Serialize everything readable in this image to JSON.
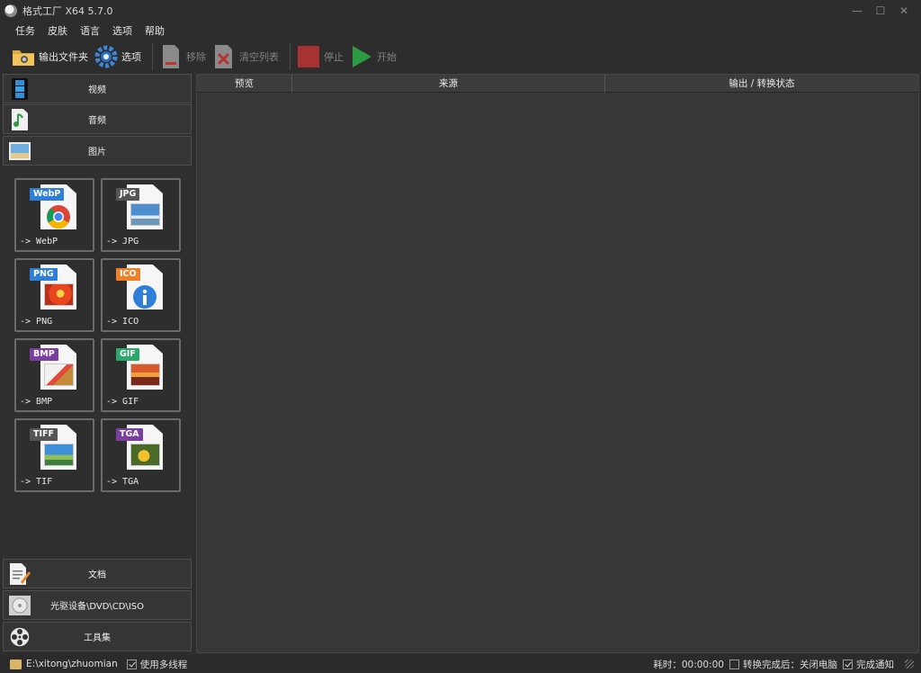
{
  "window": {
    "title": "格式工厂 X64 5.7.0",
    "controls": {
      "minimize": "—",
      "maximize": "☐",
      "close": "✕"
    }
  },
  "menu": [
    "任务",
    "皮肤",
    "语言",
    "选项",
    "帮助"
  ],
  "toolbar": {
    "output_folder": "输出文件夹",
    "options": "选项",
    "remove": "移除",
    "clear_list": "清空列表",
    "stop": "停止",
    "start": "开始"
  },
  "sidebar": {
    "categories_top": [
      {
        "label": "视频",
        "icon": "film-icon"
      },
      {
        "label": "音频",
        "icon": "music-note-icon"
      },
      {
        "label": "图片",
        "icon": "picture-icon"
      }
    ],
    "formats": [
      {
        "badge": "WebP",
        "label": "-> WebP",
        "badge_color": "#2f7fd8",
        "icon": "chrome-logo-icon"
      },
      {
        "badge": "JPG",
        "label": "-> JPG",
        "badge_color": "#555555",
        "icon": "landscape-photo-icon"
      },
      {
        "badge": "PNG",
        "label": "-> PNG",
        "badge_color": "#2f7fd8",
        "icon": "red-flower-icon"
      },
      {
        "badge": "ICO",
        "label": "-> ICO",
        "badge_color": "#f07f2a",
        "icon": "info-icon"
      },
      {
        "badge": "BMP",
        "label": "-> BMP",
        "badge_color": "#7a3fa0",
        "icon": "paint-brush-icon"
      },
      {
        "badge": "GIF",
        "label": "-> GIF",
        "badge_color": "#2aa86a",
        "icon": "sunset-photo-icon"
      },
      {
        "badge": "TIFF",
        "label": "-> TIF",
        "badge_color": "#555555",
        "icon": "landscape-photo-icon"
      },
      {
        "badge": "TGA",
        "label": "-> TGA",
        "badge_color": "#7a3fa0",
        "icon": "flower-photo-icon"
      }
    ],
    "categories_bottom": [
      {
        "label": "文档",
        "icon": "document-icon"
      },
      {
        "label": "光驱设备\\DVD\\CD\\ISO",
        "icon": "disc-drive-icon"
      },
      {
        "label": "工具集",
        "icon": "film-reel-icon"
      }
    ]
  },
  "table": {
    "columns": [
      "预览",
      "来源",
      "输出 / 转换状态"
    ]
  },
  "statusbar": {
    "output_path": "E:\\xitong\\zhuomian",
    "multithread_label": "使用多线程",
    "multithread_checked": true,
    "elapsed_label": "耗时：00:00:00",
    "after_convert_label": "转换完成后：关闭电脑",
    "after_convert_checked": false,
    "notify_label": "完成通知",
    "notify_checked": true
  }
}
